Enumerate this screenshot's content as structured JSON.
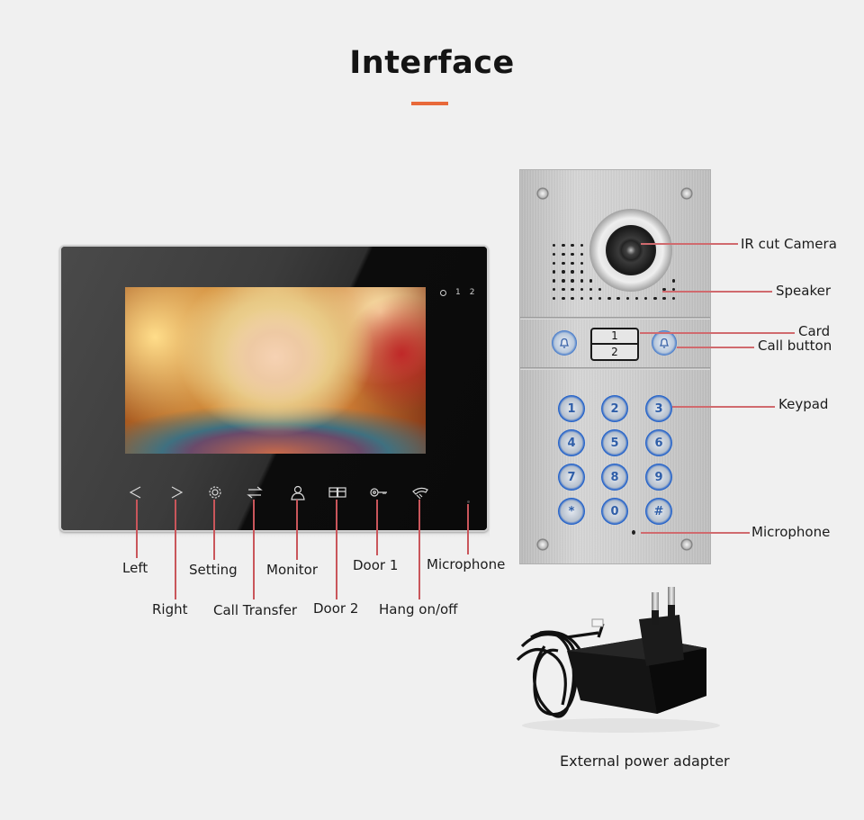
{
  "header": {
    "title": "Interface",
    "accent_color": "#e8693a"
  },
  "monitor": {
    "indicators": [
      "1",
      "2"
    ],
    "buttons": [
      {
        "id": "left",
        "icon": "chevron-left-icon",
        "label": "Left"
      },
      {
        "id": "right",
        "icon": "chevron-right-icon",
        "label": "Right"
      },
      {
        "id": "setting",
        "icon": "gear-icon",
        "label": "Setting"
      },
      {
        "id": "call-transfer",
        "icon": "transfer-arrows-icon",
        "label": "Call Transfer"
      },
      {
        "id": "monitor",
        "icon": "person-icon",
        "label": "Monitor"
      },
      {
        "id": "door-2",
        "icon": "double-door-icon",
        "label": "Door 2"
      },
      {
        "id": "door-1",
        "icon": "key-icon",
        "label": "Door 1"
      },
      {
        "id": "hang",
        "icon": "phone-handset-icon",
        "label": "Hang on/off"
      }
    ],
    "microphone_label": "Microphone"
  },
  "outdoor_panel": {
    "card_numbers": [
      "1",
      "2"
    ],
    "keypad": [
      "1",
      "2",
      "3",
      "4",
      "5",
      "6",
      "7",
      "8",
      "9",
      "*",
      "0",
      "#"
    ],
    "labels": {
      "camera": "IR cut Camera",
      "speaker": "Speaker",
      "card": "Card",
      "call_button": "Call button",
      "keypad": "Keypad",
      "microphone": "Microphone"
    }
  },
  "adapter": {
    "caption": "External power adapter"
  },
  "colors": {
    "callout_line": "#c9565b",
    "background": "#f0f0f0"
  }
}
